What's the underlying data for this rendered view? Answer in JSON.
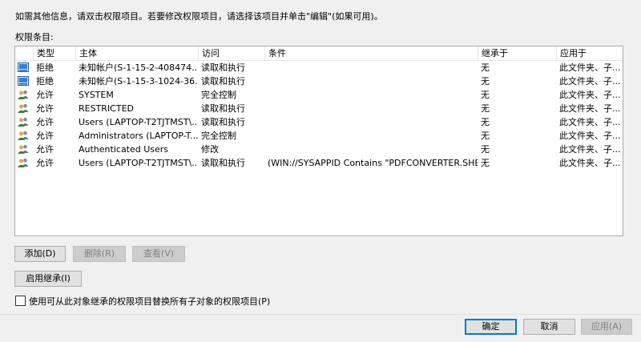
{
  "info_text": "如需其他信息，请双击权限项目。若要修改权限项目，请选择该项目并单击\"编辑\"(如果可用)。",
  "list_label": "权限条目:",
  "columns": {
    "type": "类型",
    "principal": "主体",
    "access": "访问",
    "condition": "条件",
    "inherited_from": "继承于",
    "applies_to": "应用于"
  },
  "entries": [
    {
      "icon": "app-package-icon",
      "type": "拒绝",
      "principal": "未知帐户(S-1-15-2-408474...",
      "access": "读取和执行",
      "condition": "",
      "inherited_from": "无",
      "applies_to": "此文件夹、子..."
    },
    {
      "icon": "app-package-icon",
      "type": "拒绝",
      "principal": "未知帐户(S-1-15-3-1024-36...",
      "access": "读取和执行",
      "condition": "",
      "inherited_from": "无",
      "applies_to": "此文件夹、子..."
    },
    {
      "icon": "users-icon",
      "type": "允许",
      "principal": "SYSTEM",
      "access": "完全控制",
      "condition": "",
      "inherited_from": "无",
      "applies_to": "此文件夹、子..."
    },
    {
      "icon": "users-icon",
      "type": "允许",
      "principal": "RESTRICTED",
      "access": "读取和执行",
      "condition": "",
      "inherited_from": "无",
      "applies_to": "此文件夹、子..."
    },
    {
      "icon": "users-icon",
      "type": "允许",
      "principal": "Users (LAPTOP-T2TJTMST\\...",
      "access": "读取和执行",
      "condition": "",
      "inherited_from": "无",
      "applies_to": "此文件夹、子..."
    },
    {
      "icon": "users-icon",
      "type": "允许",
      "principal": "Administrators (LAPTOP-T...",
      "access": "完全控制",
      "condition": "",
      "inherited_from": "无",
      "applies_to": "此文件夹、子..."
    },
    {
      "icon": "users-icon",
      "type": "允许",
      "principal": "Authenticated Users",
      "access": "修改",
      "condition": "",
      "inherited_from": "无",
      "applies_to": "此文件夹、子..."
    },
    {
      "icon": "users-icon",
      "type": "允许",
      "principal": "Users (LAPTOP-T2TJTMST\\...",
      "access": "读取和执行",
      "condition": "(WIN://SYSAPPID Contains \"PDFCONVERTER.SHE...",
      "inherited_from": "无",
      "applies_to": "此文件夹、子..."
    }
  ],
  "buttons": {
    "add": "添加(D)",
    "remove": "删除(R)",
    "view": "查看(V)",
    "enable_inheritance": "启用继承(I)",
    "ok": "确定",
    "cancel": "取消",
    "apply": "应用(A)"
  },
  "replace_checkbox": {
    "label": "使用可从此对象继承的权限项目替换所有子对象的权限项目(P)",
    "checked": false
  },
  "colors": {
    "accent": "#0078d7",
    "disabled_text": "#838383"
  }
}
